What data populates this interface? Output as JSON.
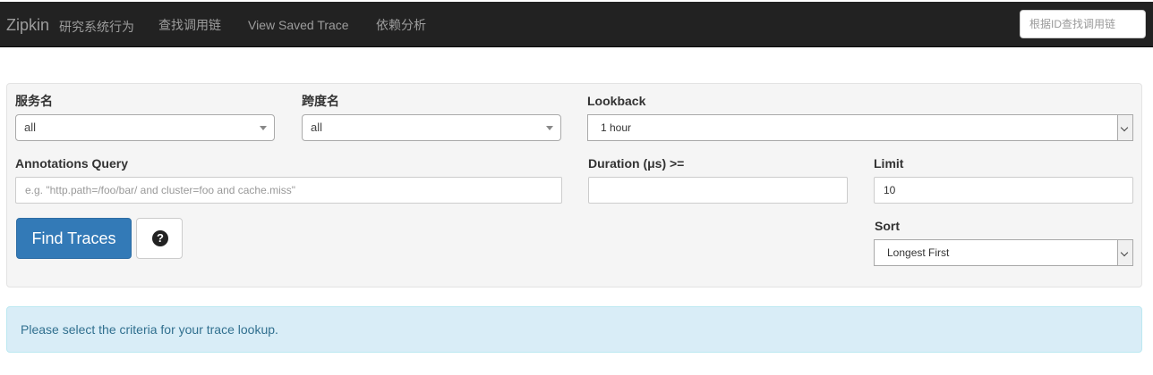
{
  "navbar": {
    "brand": "Zipkin",
    "brand_subtitle": "研究系统行为",
    "links": [
      "查找调用链",
      "View Saved Trace",
      "依赖分析"
    ],
    "search_placeholder": "根据ID查找调用链"
  },
  "form": {
    "service": {
      "label": "服务名",
      "value": "all"
    },
    "span": {
      "label": "跨度名",
      "value": "all"
    },
    "lookback": {
      "label": "Lookback",
      "value": "1 hour"
    },
    "annotations": {
      "label": "Annotations Query",
      "placeholder": "e.g. \"http.path=/foo/bar/ and cluster=foo and cache.miss\"",
      "value": ""
    },
    "duration": {
      "label": "Duration (μs) >=",
      "value": ""
    },
    "limit": {
      "label": "Limit",
      "value": "10"
    },
    "sort": {
      "label": "Sort",
      "value": "Longest First"
    },
    "find_button": "Find Traces",
    "help_icon_text": "?"
  },
  "alert": {
    "message": "Please select the criteria for your trace lookup."
  }
}
